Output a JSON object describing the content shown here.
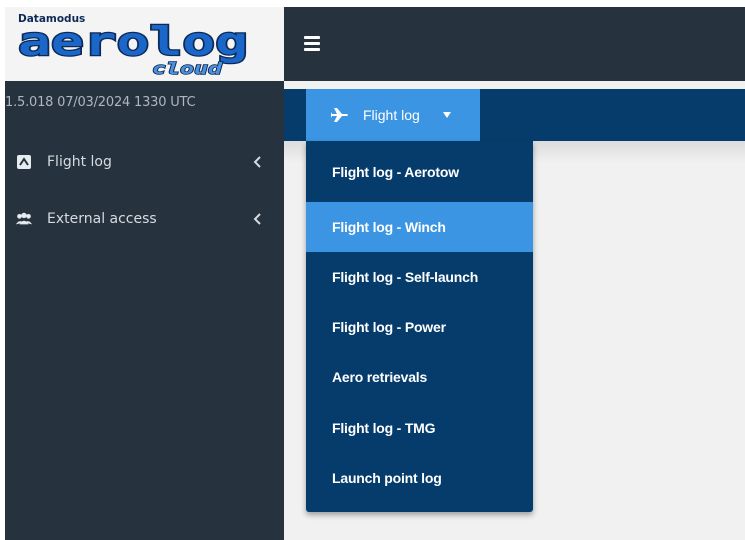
{
  "brand": {
    "top_text": "Datamodus",
    "name": "aerolog",
    "sub_text": "cloud"
  },
  "version_text": "1.5.018 07/03/2024 1330 UTC",
  "sidebar": {
    "items": [
      {
        "label": "Flight log",
        "icon": "logbook-icon"
      },
      {
        "label": "External access",
        "icon": "users-icon"
      }
    ]
  },
  "navbar": {
    "button_label": "Flight log",
    "button_icon": "plane-icon"
  },
  "dropdown": {
    "items": [
      {
        "label": "Flight log - Aerotow",
        "active": false
      },
      {
        "label": "Flight log - Winch",
        "active": true
      },
      {
        "label": "Flight log - Self-launch",
        "active": false
      },
      {
        "label": "Flight log - Power",
        "active": false
      },
      {
        "label": "Aero retrievals",
        "active": false
      },
      {
        "label": "Flight log - TMG",
        "active": false
      },
      {
        "label": "Launch point log",
        "active": false
      }
    ]
  },
  "colors": {
    "sidebar_bg": "#27323f",
    "navbar_bg": "#053c6b",
    "accent": "#3b95e3",
    "content_bg": "#f1f1f1"
  }
}
